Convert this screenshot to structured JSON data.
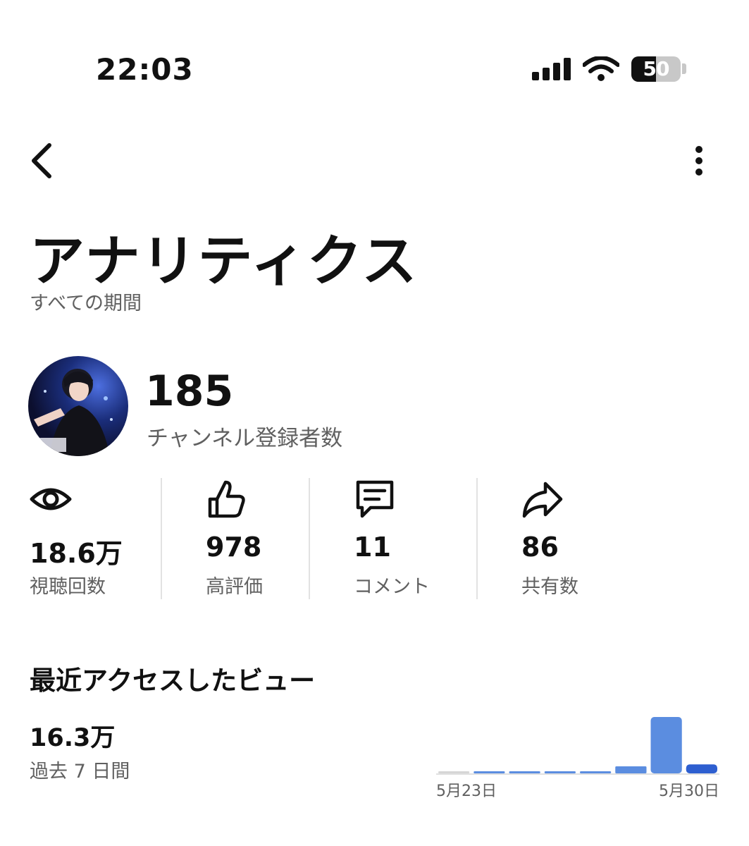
{
  "status_bar": {
    "time": "22:03",
    "battery": "50",
    "battery_level": 0.5
  },
  "header": {
    "title": "アナリティクス",
    "period": "すべての期間"
  },
  "channel": {
    "subscribers": "185",
    "subscribers_label": "チャンネル登録者数"
  },
  "stats": [
    {
      "icon": "eye-icon",
      "value": "18.6万",
      "label": "視聴回数"
    },
    {
      "icon": "thumbs-up-icon",
      "value": "978",
      "label": "高評価"
    },
    {
      "icon": "comment-icon",
      "value": "11",
      "label": "コメント"
    },
    {
      "icon": "share-icon",
      "value": "86",
      "label": "共有数"
    }
  ],
  "recent": {
    "title": "最近アクセスしたビュー",
    "value": "16.3万",
    "period_label": "過去 7 日間"
  },
  "chart_data": {
    "type": "bar",
    "categories": [
      "5月23日",
      "",
      "",
      "",
      "",
      "",
      "5月30日",
      ""
    ],
    "values": [
      0,
      300,
      300,
      300,
      300,
      2500,
      20000,
      3200
    ],
    "colors": [
      "#d6d6d6",
      "#5b8de0",
      "#5b8de0",
      "#5b8de0",
      "#5b8de0",
      "#5b8de0",
      "#5b8de0",
      "#2e5fd0"
    ],
    "tick_labels": {
      "start": "5月23日",
      "end": "5月30日"
    },
    "ylim": [
      0,
      20000
    ]
  }
}
